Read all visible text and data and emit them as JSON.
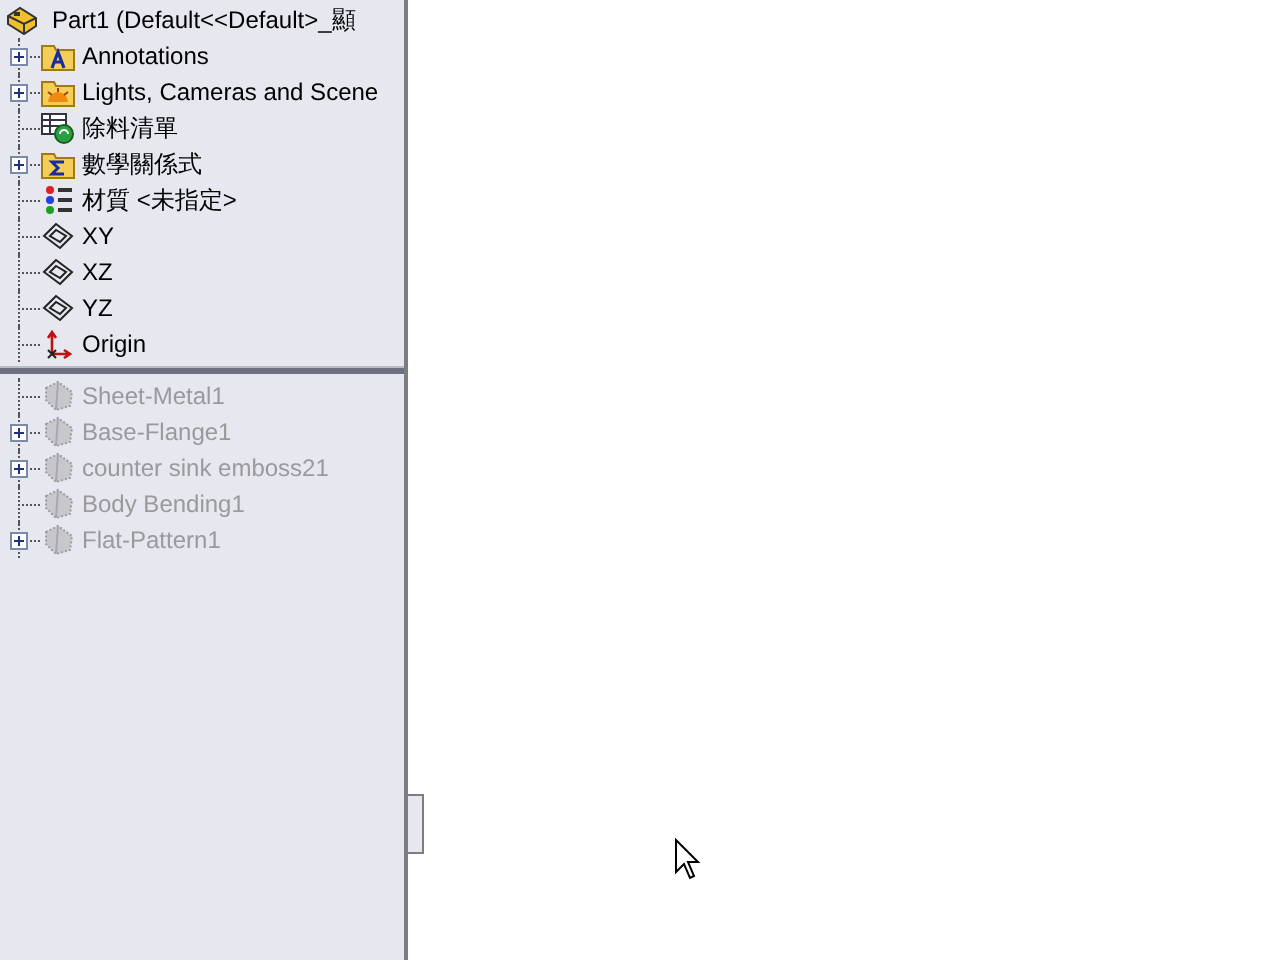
{
  "tree": {
    "root": {
      "label": "Part1  (Default<<Default>_顯",
      "kind": "part"
    },
    "items": [
      {
        "label": "Annotations",
        "kind": "annotations",
        "expandable": true,
        "disabled": false
      },
      {
        "label": "Lights, Cameras and Scene",
        "kind": "lights",
        "expandable": true,
        "disabled": false
      },
      {
        "label": "除料清單",
        "kind": "cutlist",
        "expandable": false,
        "disabled": false
      },
      {
        "label": "數學關係式",
        "kind": "equations",
        "expandable": true,
        "disabled": false
      },
      {
        "label": "材質 <未指定>",
        "kind": "material",
        "expandable": false,
        "disabled": false
      },
      {
        "label": "XY",
        "kind": "plane",
        "expandable": false,
        "disabled": false
      },
      {
        "label": "XZ",
        "kind": "plane",
        "expandable": false,
        "disabled": false
      },
      {
        "label": "YZ",
        "kind": "plane",
        "expandable": false,
        "disabled": false
      },
      {
        "label": "Origin",
        "kind": "origin",
        "expandable": false,
        "disabled": false
      },
      {
        "kind": "rollback"
      },
      {
        "label": "Sheet-Metal1",
        "kind": "feature",
        "expandable": false,
        "disabled": true
      },
      {
        "label": "Base-Flange1",
        "kind": "feature",
        "expandable": true,
        "disabled": true
      },
      {
        "label": "counter sink emboss21",
        "kind": "feature",
        "expandable": true,
        "disabled": true
      },
      {
        "label": "Body Bending1",
        "kind": "feature",
        "expandable": false,
        "disabled": true
      },
      {
        "label": "Flat-Pattern1",
        "kind": "feature",
        "expandable": true,
        "disabled": true
      }
    ]
  }
}
